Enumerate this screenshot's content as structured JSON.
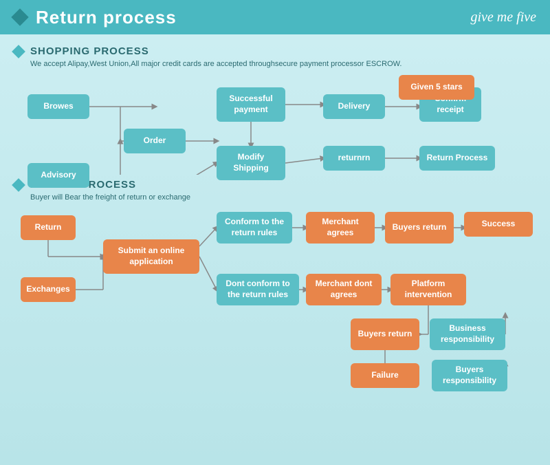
{
  "header": {
    "title": "Return process",
    "logo": "give me five"
  },
  "shopping": {
    "section_title": "SHOPPING PROCESS",
    "desc": "We accept Alipay,West Union,All major credit cards are accepted throughsecure payment processor ESCROW.",
    "boxes": {
      "browes": "Browes",
      "order": "Order",
      "advisory": "Advisory",
      "modify": "Modify Shipping",
      "payment": "Successful payment",
      "delivery": "Delivery",
      "confirm": "Confirm receipt",
      "given5": "Given 5 stars",
      "returnm": "returnrn",
      "returnp": "Return Process"
    }
  },
  "return": {
    "section_title": "RETURN PROCESS",
    "desc": "Buyer will Bear the freight of return or exchange",
    "boxes": {
      "return_box": "Return",
      "exchanges": "Exchanges",
      "submit": "Submit an online application",
      "conform": "Conform to the return rules",
      "dontconform": "Dont conform to the return rules",
      "merchant_agrees": "Merchant agrees",
      "merchant_dont": "Merchant dont agrees",
      "buyers_return1": "Buyers return",
      "platform": "Platform intervention",
      "success": "Success",
      "buyers_return2": "Buyers return",
      "business_resp": "Business responsibility",
      "failure": "Failure",
      "buyers_resp": "Buyers responsibility"
    }
  }
}
